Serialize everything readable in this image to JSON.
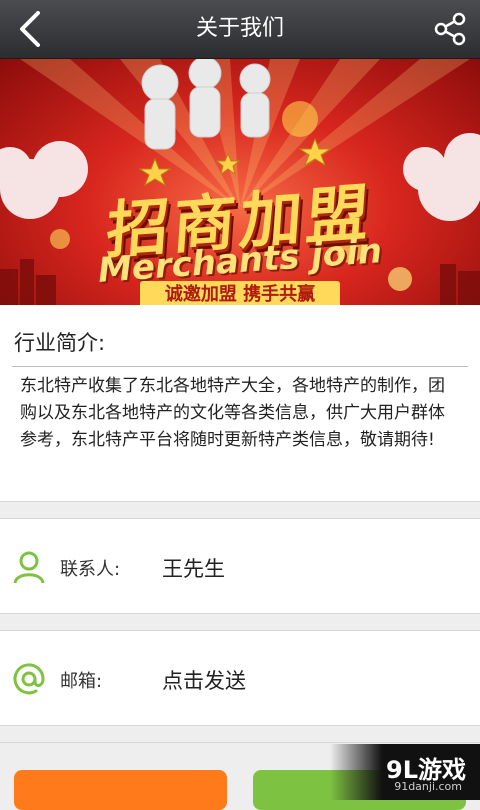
{
  "header": {
    "title": "关于我们",
    "back_icon": "back-arrow-icon",
    "share_icon": "share-icon"
  },
  "banner": {
    "headline": "招商加盟",
    "english": "Merchants join",
    "slogan": "诚邀加盟  携手共赢"
  },
  "intro": {
    "label": "行业简介:",
    "text": "东北特产收集了东北各地特产大全，各地特产的制作，团购以及东北各地特产的文化等各类信息，供广大用户群体参考，东北特产平台将随时更新特产类信息，敬请期待!"
  },
  "contact": {
    "label": "联系人:",
    "value": "王先生",
    "icon": "person-icon"
  },
  "email": {
    "label": "邮箱:",
    "value": "点击发送",
    "icon": "at-sign-icon"
  },
  "watermark": {
    "main": "9L游戏",
    "sub": "91danji.com"
  },
  "colors": {
    "topbar": "#2b2d30",
    "accent_green": "#7ec242",
    "accent_orange": "#ff7a1a",
    "banner_red": "#d8261e"
  }
}
